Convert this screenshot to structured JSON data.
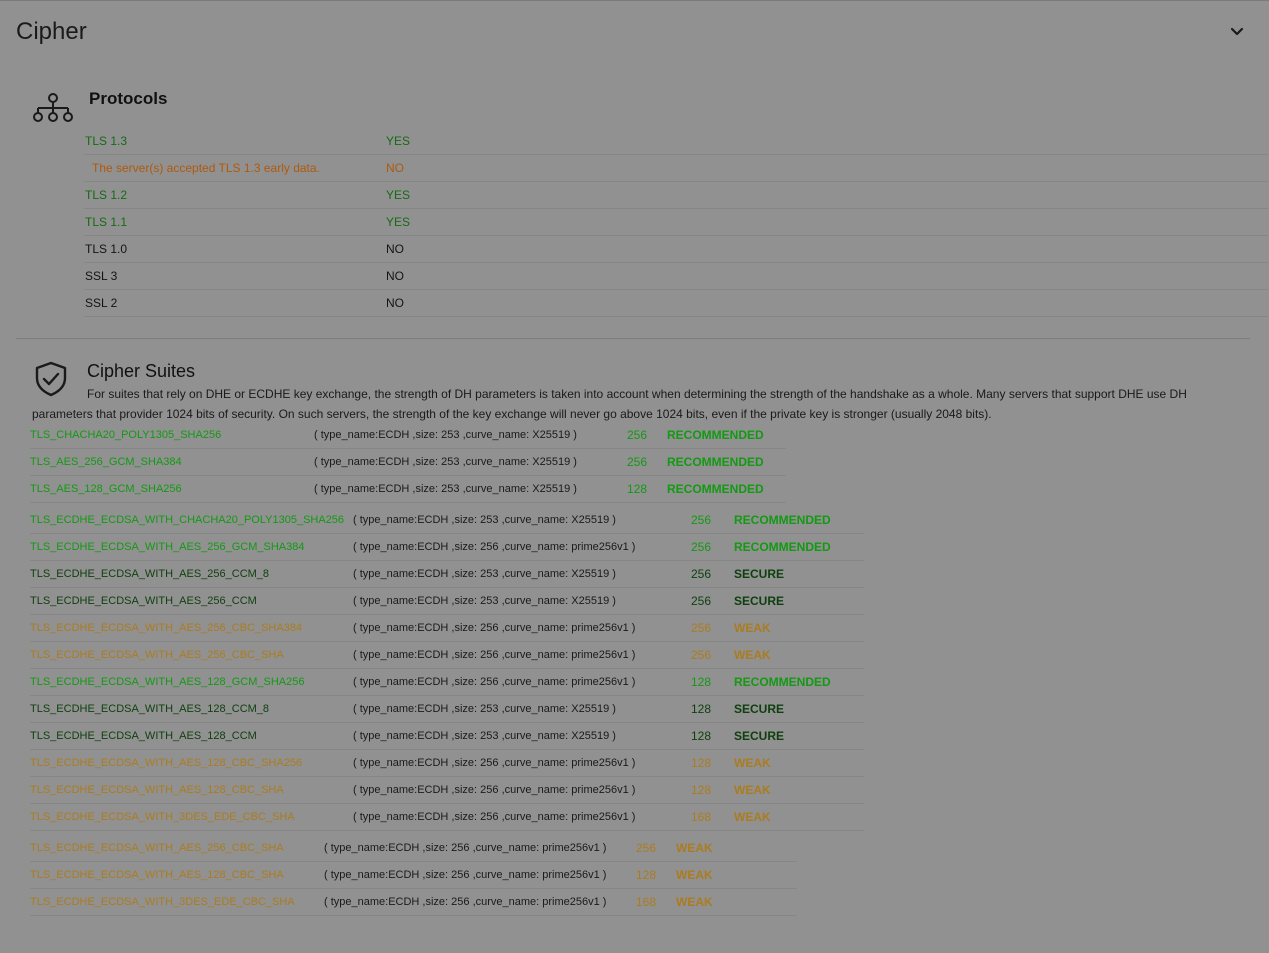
{
  "section": {
    "title": "Cipher",
    "toggle_icon": "chevron-down-icon"
  },
  "protocols": {
    "heading": "Protocols",
    "icon": "network-tree-icon",
    "rows": [
      {
        "name": "TLS 1.3",
        "value": "YES",
        "status": "ok"
      },
      {
        "name": "The server(s) accepted TLS 1.3 early data.",
        "value": "NO",
        "status": "early"
      },
      {
        "name": "TLS 1.2",
        "value": "YES",
        "status": "ok"
      },
      {
        "name": "TLS 1.1",
        "value": "YES",
        "status": "ok"
      },
      {
        "name": "TLS 1.0",
        "value": "NO",
        "status": "neutral"
      },
      {
        "name": "SSL 3",
        "value": "NO",
        "status": "neutral"
      },
      {
        "name": "SSL 2",
        "value": "NO",
        "status": "neutral"
      }
    ]
  },
  "cipher_suites": {
    "heading": "Cipher Suites",
    "icon": "shield-check-icon",
    "description": "For suites that rely on DHE or ECDHE key exchange, the strength of DH parameters is taken into account when determining the strength of the handshake as a whole. Many servers that support DHE use DH parameters that provider 1024 bits of security. On such servers, the strength of the key exchange will never go above 1024 bits, even if the private key is stronger (usually 2048 bits).",
    "groups": [
      [
        {
          "name": "TLS_CHACHA20_POLY1305_SHA256",
          "params": "( type_name:ECDH ,size: 253 ,curve_name: X25519 )",
          "bits": "256",
          "strength": "RECOMMENDED"
        },
        {
          "name": "TLS_AES_256_GCM_SHA384",
          "params": "( type_name:ECDH ,size: 253 ,curve_name: X25519 )",
          "bits": "256",
          "strength": "RECOMMENDED"
        },
        {
          "name": "TLS_AES_128_GCM_SHA256",
          "params": "( type_name:ECDH ,size: 253 ,curve_name: X25519 )",
          "bits": "128",
          "strength": "RECOMMENDED"
        }
      ],
      [
        {
          "name": "TLS_ECDHE_ECDSA_WITH_CHACHA20_POLY1305_SHA256",
          "params": "( type_name:ECDH ,size: 253 ,curve_name: X25519 )",
          "bits": "256",
          "strength": "RECOMMENDED"
        },
        {
          "name": "TLS_ECDHE_ECDSA_WITH_AES_256_GCM_SHA384",
          "params": "( type_name:ECDH ,size: 256 ,curve_name: prime256v1 )",
          "bits": "256",
          "strength": "RECOMMENDED"
        },
        {
          "name": "TLS_ECDHE_ECDSA_WITH_AES_256_CCM_8",
          "params": "( type_name:ECDH ,size: 253 ,curve_name: X25519 )",
          "bits": "256",
          "strength": "SECURE"
        },
        {
          "name": "TLS_ECDHE_ECDSA_WITH_AES_256_CCM",
          "params": "( type_name:ECDH ,size: 253 ,curve_name: X25519 )",
          "bits": "256",
          "strength": "SECURE"
        },
        {
          "name": "TLS_ECDHE_ECDSA_WITH_AES_256_CBC_SHA384",
          "params": "( type_name:ECDH ,size: 256 ,curve_name: prime256v1 )",
          "bits": "256",
          "strength": "WEAK"
        },
        {
          "name": "TLS_ECDHE_ECDSA_WITH_AES_256_CBC_SHA",
          "params": "( type_name:ECDH ,size: 256 ,curve_name: prime256v1 )",
          "bits": "256",
          "strength": "WEAK"
        },
        {
          "name": "TLS_ECDHE_ECDSA_WITH_AES_128_GCM_SHA256",
          "params": "( type_name:ECDH ,size: 256 ,curve_name: prime256v1 )",
          "bits": "128",
          "strength": "RECOMMENDED"
        },
        {
          "name": "TLS_ECDHE_ECDSA_WITH_AES_128_CCM_8",
          "params": "( type_name:ECDH ,size: 253 ,curve_name: X25519 )",
          "bits": "128",
          "strength": "SECURE"
        },
        {
          "name": "TLS_ECDHE_ECDSA_WITH_AES_128_CCM",
          "params": "( type_name:ECDH ,size: 253 ,curve_name: X25519 )",
          "bits": "128",
          "strength": "SECURE"
        },
        {
          "name": "TLS_ECDHE_ECDSA_WITH_AES_128_CBC_SHA256",
          "params": "( type_name:ECDH ,size: 256 ,curve_name: prime256v1 )",
          "bits": "128",
          "strength": "WEAK"
        },
        {
          "name": "TLS_ECDHE_ECDSA_WITH_AES_128_CBC_SHA",
          "params": "( type_name:ECDH ,size: 256 ,curve_name: prime256v1 )",
          "bits": "128",
          "strength": "WEAK"
        },
        {
          "name": "TLS_ECDHE_ECDSA_WITH_3DES_EDE_CBC_SHA",
          "params": "( type_name:ECDH ,size: 256 ,curve_name: prime256v1 )",
          "bits": "168",
          "strength": "WEAK"
        }
      ],
      [
        {
          "name": "TLS_ECDHE_ECDSA_WITH_AES_256_CBC_SHA",
          "params": "( type_name:ECDH ,size: 256 ,curve_name: prime256v1 )",
          "bits": "256",
          "strength": "WEAK"
        },
        {
          "name": "TLS_ECDHE_ECDSA_WITH_AES_128_CBC_SHA",
          "params": "( type_name:ECDH ,size: 256 ,curve_name: prime256v1 )",
          "bits": "128",
          "strength": "WEAK"
        },
        {
          "name": "TLS_ECDHE_ECDSA_WITH_3DES_EDE_CBC_SHA",
          "params": "( type_name:ECDH ,size: 256 ,curve_name: prime256v1 )",
          "bits": "168",
          "strength": "WEAK"
        }
      ]
    ]
  },
  "colors": {
    "background": "#919191",
    "recommended": "#129a12",
    "secure": "#0e3f0e",
    "weak": "#ab7c1f",
    "early_data": "#ad5a0f",
    "protocol_yes": "#146b14"
  }
}
